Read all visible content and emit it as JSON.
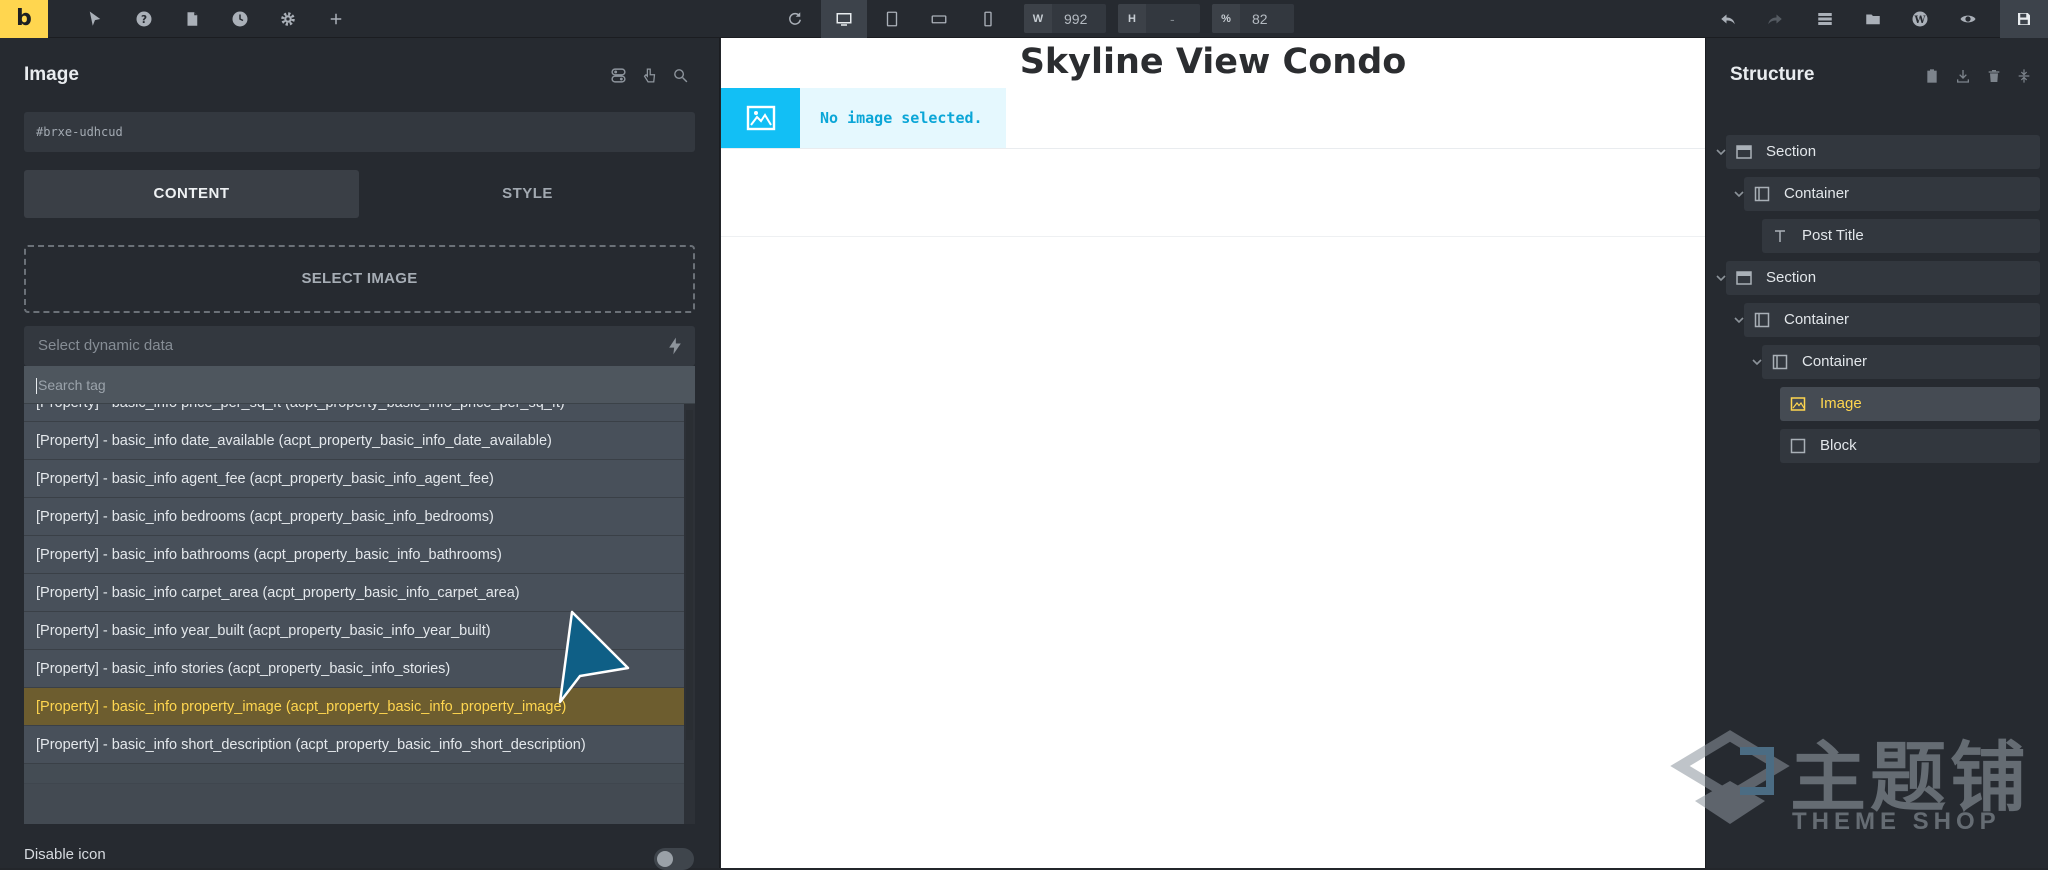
{
  "app": {
    "logo_letter": "b",
    "accent_color": "#ffd64f",
    "placeholder_blue": "#12bff5"
  },
  "toolbar": {
    "icons": [
      "pointer-icon",
      "help-icon",
      "pages-icon",
      "history-icon",
      "settings-icon",
      "add-icon"
    ],
    "right_icons": [
      "refresh-icon",
      "desktop-icon",
      "tablet-portrait-icon",
      "mobile-landscape-icon",
      "mobile-portrait-icon"
    ],
    "width_label": "W",
    "width_value": "992",
    "height_label": "H",
    "height_value": "-",
    "zoom_label": "%",
    "zoom_value": "82",
    "far_right_icons": [
      "undo-icon",
      "redo-icon",
      "structure-icon",
      "folder-icon",
      "wordpress-icon",
      "preview-icon",
      "save-icon"
    ]
  },
  "left_panel": {
    "title": "Image",
    "element_id": "#brxe-udhcud",
    "tabs": [
      {
        "label": "CONTENT",
        "active": true
      },
      {
        "label": "STYLE",
        "active": false
      }
    ],
    "select_image_label": "SELECT IMAGE",
    "dynamic_data_placeholder": "Select dynamic data",
    "search_placeholder": "Search tag",
    "dropdown_items": [
      {
        "label": "[Property] - basic_info price_per_sq_ft (acpt_property_basic_info_price_per_sq_ft)",
        "highlighted": false
      },
      {
        "label": "[Property] - basic_info date_available (acpt_property_basic_info_date_available)",
        "highlighted": false
      },
      {
        "label": "[Property] - basic_info agent_fee (acpt_property_basic_info_agent_fee)",
        "highlighted": false
      },
      {
        "label": "[Property] - basic_info bedrooms (acpt_property_basic_info_bedrooms)",
        "highlighted": false
      },
      {
        "label": "[Property] - basic_info bathrooms (acpt_property_basic_info_bathrooms)",
        "highlighted": false
      },
      {
        "label": "[Property] - basic_info carpet_area (acpt_property_basic_info_carpet_area)",
        "highlighted": false
      },
      {
        "label": "[Property] - basic_info year_built (acpt_property_basic_info_year_built)",
        "highlighted": false
      },
      {
        "label": "[Property] - basic_info stories (acpt_property_basic_info_stories)",
        "highlighted": false
      },
      {
        "label": "[Property] - basic_info property_image (acpt_property_basic_info_property_image)",
        "highlighted": true
      },
      {
        "label": "[Property] - basic_info short_description (acpt_property_basic_info_short_description)",
        "highlighted": false
      }
    ],
    "disable_icon_label": "Disable icon"
  },
  "canvas": {
    "post_title": "Skyline View Condo",
    "image_placeholder_text": "No image selected."
  },
  "structure": {
    "title": "Structure",
    "tree": [
      {
        "label": "Section",
        "icon": "section-icon",
        "depth": 0,
        "expanded": true,
        "selected": false
      },
      {
        "label": "Container",
        "icon": "container-icon",
        "depth": 1,
        "expanded": true,
        "selected": false
      },
      {
        "label": "Post Title",
        "icon": "text-icon",
        "depth": 2,
        "expanded": null,
        "selected": false
      },
      {
        "label": "Section",
        "icon": "section-icon",
        "depth": 0,
        "expanded": true,
        "selected": false
      },
      {
        "label": "Container",
        "icon": "container-icon",
        "depth": 1,
        "expanded": true,
        "selected": false
      },
      {
        "label": "Container",
        "icon": "container-icon",
        "depth": 2,
        "expanded": true,
        "selected": false
      },
      {
        "label": "Image",
        "icon": "image-icon",
        "depth": 3,
        "expanded": null,
        "selected": true
      },
      {
        "label": "Block",
        "icon": "block-icon",
        "depth": 3,
        "expanded": null,
        "selected": false
      }
    ]
  },
  "watermark": {
    "cn_text": "主题铺",
    "en_text": "THEME SHOP"
  }
}
